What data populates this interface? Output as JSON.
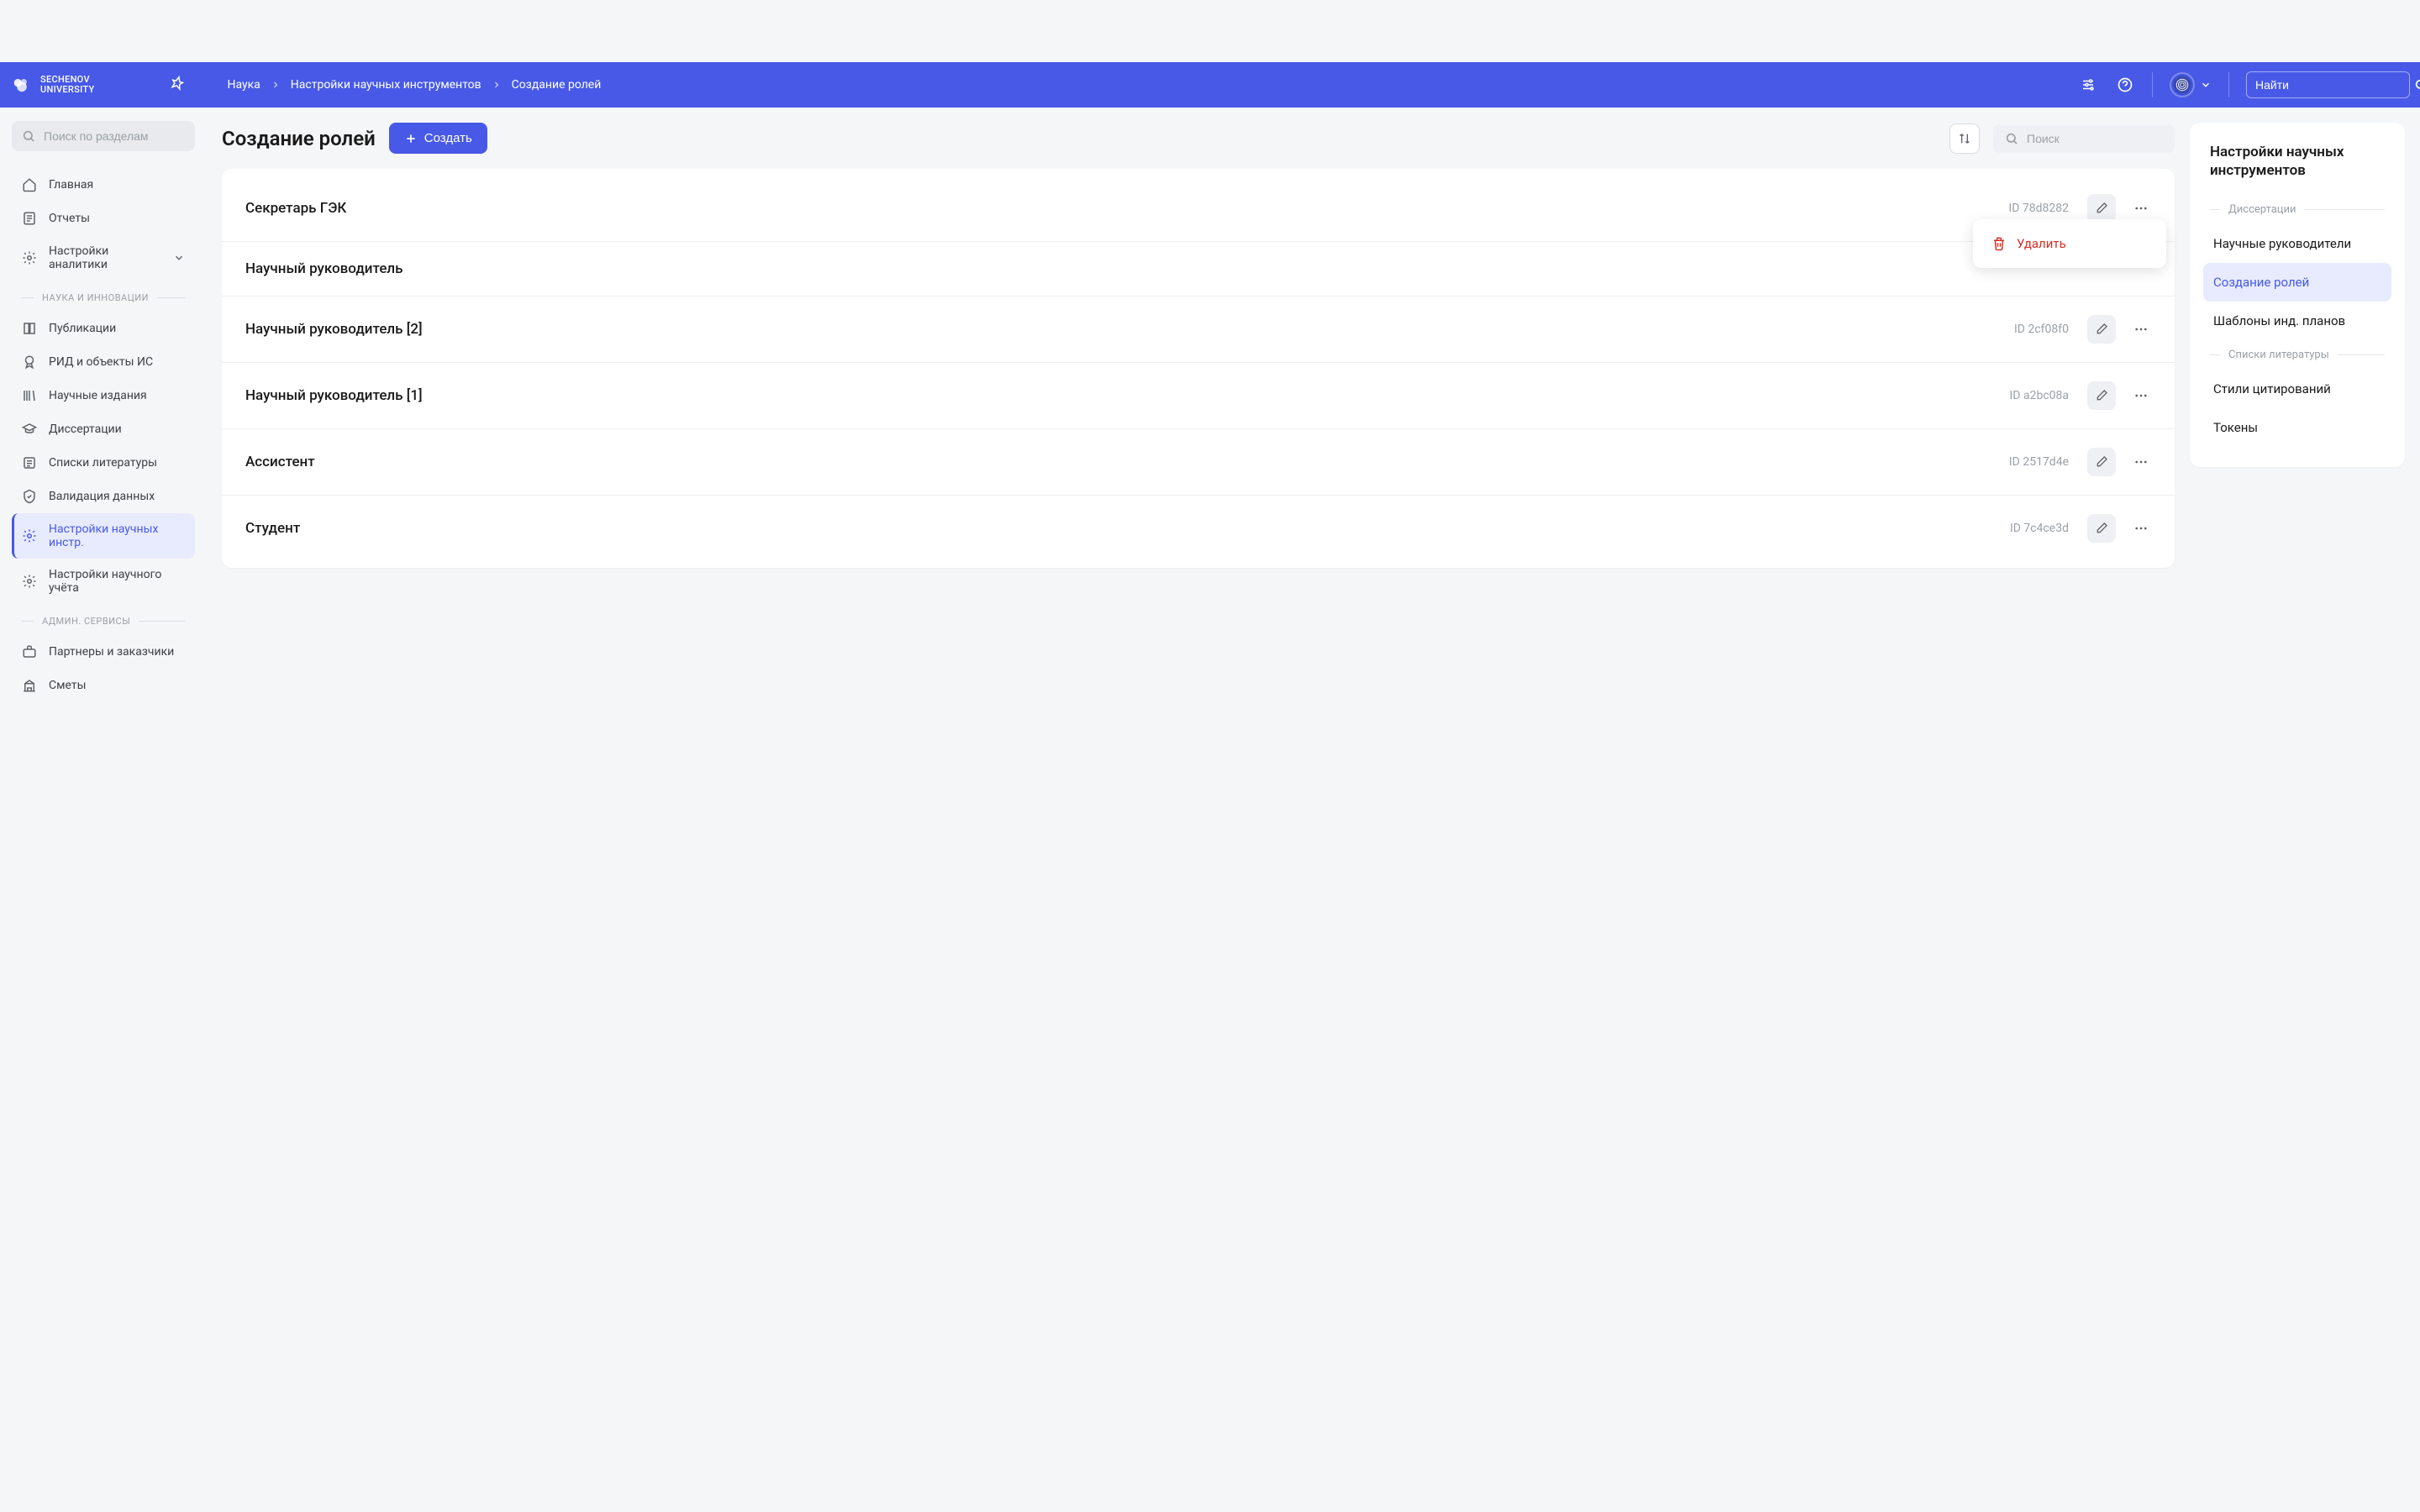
{
  "header": {
    "logo_text_1": "SECHENOV",
    "logo_text_2": "UNIVERSITY",
    "search_placeholder": "Найти"
  },
  "breadcrumbs": {
    "items": [
      {
        "label": "Наука"
      },
      {
        "label": "Настройки научных инструментов"
      },
      {
        "label": "Создание ролей"
      }
    ]
  },
  "sidebar": {
    "search_placeholder": "Поиск по разделам",
    "items_top": [
      {
        "label": "Главная"
      },
      {
        "label": "Отчеты"
      },
      {
        "label": "Настройки аналитики"
      }
    ],
    "section_1": "НАУКА И ИННОВАЦИИ",
    "items_science": [
      {
        "label": "Публикации"
      },
      {
        "label": "РИД и объекты ИС"
      },
      {
        "label": "Научные издания"
      },
      {
        "label": "Диссертации"
      },
      {
        "label": "Списки литературы"
      },
      {
        "label": "Валидация данных"
      },
      {
        "label": "Настройки научных инстр."
      },
      {
        "label": "Настройки научного учёта"
      }
    ],
    "section_2": "АДМИН. СЕРВИСЫ",
    "items_admin": [
      {
        "label": "Партнеры и заказчики"
      },
      {
        "label": "Сметы"
      }
    ]
  },
  "page": {
    "title": "Создание ролей",
    "create_button": "Создать",
    "search_placeholder": "Поиск"
  },
  "roles": [
    {
      "name": "Секретарь ГЭК",
      "id": "ID 78d8282"
    },
    {
      "name": "Научный руководитель",
      "id": ""
    },
    {
      "name": "Научный руководитель [2]",
      "id": "ID 2cf08f0"
    },
    {
      "name": "Научный руководитель [1]",
      "id": "ID a2bc08a"
    },
    {
      "name": "Ассистент",
      "id": "ID 2517d4e"
    },
    {
      "name": "Студент",
      "id": "ID 7c4ce3d"
    }
  ],
  "dropdown": {
    "delete": "Удалить"
  },
  "right_panel": {
    "title": "Настройки научных инструментов",
    "section_1": "Диссертации",
    "items_1": [
      {
        "label": "Научные руководители"
      },
      {
        "label": "Создание ролей"
      },
      {
        "label": "Шаблоны инд. планов"
      }
    ],
    "section_2": "Списки литературы",
    "items_2": [
      {
        "label": "Стили цитирований"
      },
      {
        "label": "Токены"
      }
    ]
  }
}
